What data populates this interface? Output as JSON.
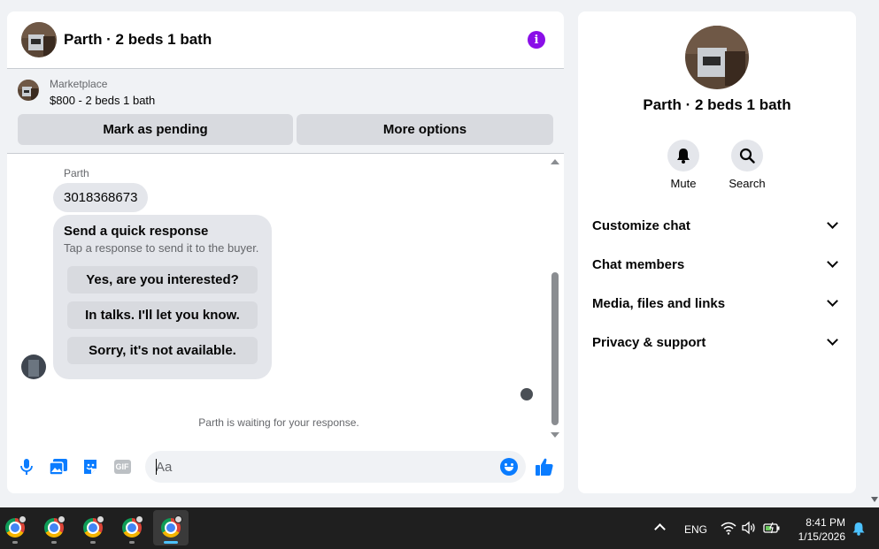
{
  "chat": {
    "title": "Parth · 2 beds 1 bath",
    "marketplace": {
      "label": "Marketplace",
      "listing": "$800 - 2 beds 1 bath",
      "buttons": {
        "pending": "Mark as pending",
        "more": "More options"
      }
    },
    "messages": {
      "sender": "Parth",
      "number": "3018368673",
      "quick_response": {
        "title": "Send a quick response",
        "subtitle": "Tap a response to send it to the buyer.",
        "options": [
          "Yes, are you interested?",
          "In talks. I'll let you know.",
          "Sorry, it's not available."
        ]
      },
      "waiting": "Parth is waiting for your response."
    },
    "composer": {
      "placeholder": "Aa",
      "gif_label": "GIF"
    }
  },
  "info_panel": {
    "title": "Parth · 2 beds 1 bath",
    "actions": {
      "mute": "Mute",
      "search": "Search"
    },
    "sections": [
      "Customize chat",
      "Chat members",
      "Media, files and links",
      "Privacy & support"
    ]
  },
  "taskbar": {
    "language": "ENG",
    "time": "8:41 PM",
    "date": "1/15/2026"
  },
  "colors": {
    "accent": "#0a7cff",
    "info_purple": "#8a0fe8",
    "taskbar_bg": "#1f1f1f",
    "page_bg": "#f0f2f5"
  },
  "icons": [
    "info-icon",
    "microphone-icon",
    "photo-icon",
    "sticker-icon",
    "gif-icon",
    "emoji-icon",
    "thumbs-up-icon",
    "bell-icon",
    "search-icon",
    "chevron-down-icon",
    "chrome-icon",
    "wifi-icon",
    "volume-icon",
    "battery-icon",
    "notification-bell-icon"
  ]
}
